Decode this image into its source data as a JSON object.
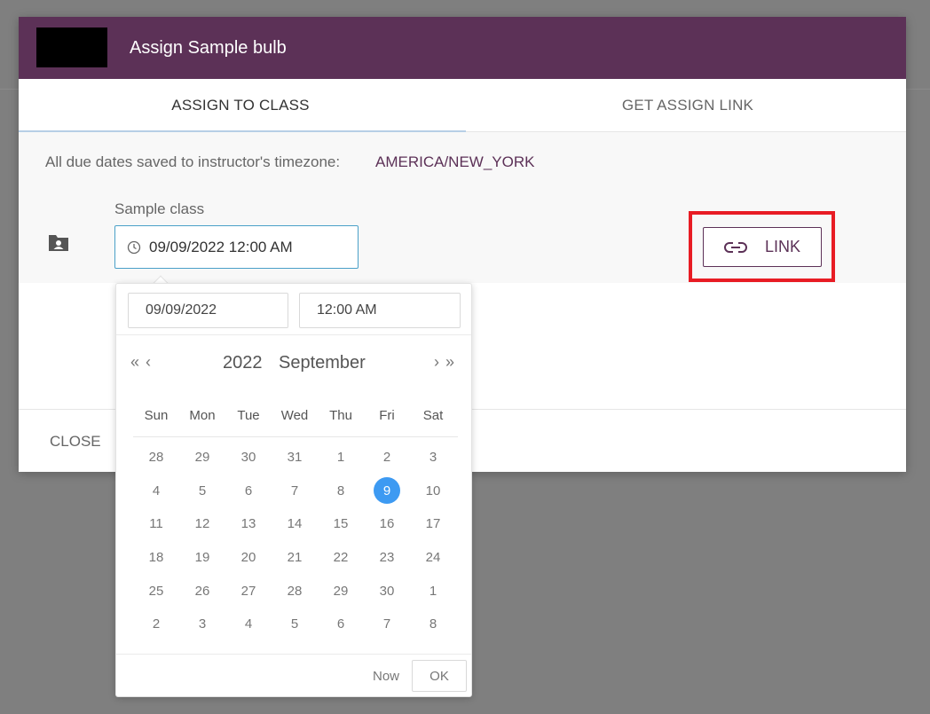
{
  "header": {
    "title": "Assign Sample bulb"
  },
  "tabs": [
    {
      "label": "ASSIGN TO CLASS",
      "active": true
    },
    {
      "label": "GET ASSIGN LINK",
      "active": false
    }
  ],
  "timezone": {
    "label": "All due dates saved to instructor's timezone:",
    "value": "AMERICA/NEW_YORK"
  },
  "class_row": {
    "class_name": "Sample class",
    "due_date_value": "09/09/2022 12:00 AM",
    "link_label": "LINK"
  },
  "footer": {
    "close_label": "CLOSE"
  },
  "picker": {
    "date_value": "09/09/2022",
    "time_value": "12:00 AM",
    "year": "2022",
    "month": "September",
    "nav": {
      "prev_year": "«",
      "prev_month": "‹",
      "next_month": "›",
      "next_year": "»"
    },
    "weekdays": [
      "Sun",
      "Mon",
      "Tue",
      "Wed",
      "Thu",
      "Fri",
      "Sat"
    ],
    "weeks": [
      [
        "28",
        "29",
        "30",
        "31",
        "1",
        "2",
        "3"
      ],
      [
        "4",
        "5",
        "6",
        "7",
        "8",
        "9",
        "10"
      ],
      [
        "11",
        "12",
        "13",
        "14",
        "15",
        "16",
        "17"
      ],
      [
        "18",
        "19",
        "20",
        "21",
        "22",
        "23",
        "24"
      ],
      [
        "25",
        "26",
        "27",
        "28",
        "29",
        "30",
        "1"
      ],
      [
        "2",
        "3",
        "4",
        "5",
        "6",
        "7",
        "8"
      ]
    ],
    "selected_day": "9",
    "now_label": "Now",
    "ok_label": "OK"
  },
  "colors": {
    "header_bg": "#5c3157",
    "accent": "#3d9af2",
    "highlight": "#e81c24"
  },
  "icons": {
    "folder": "folder-account-icon",
    "clock": "clock-icon",
    "link": "link-icon"
  }
}
